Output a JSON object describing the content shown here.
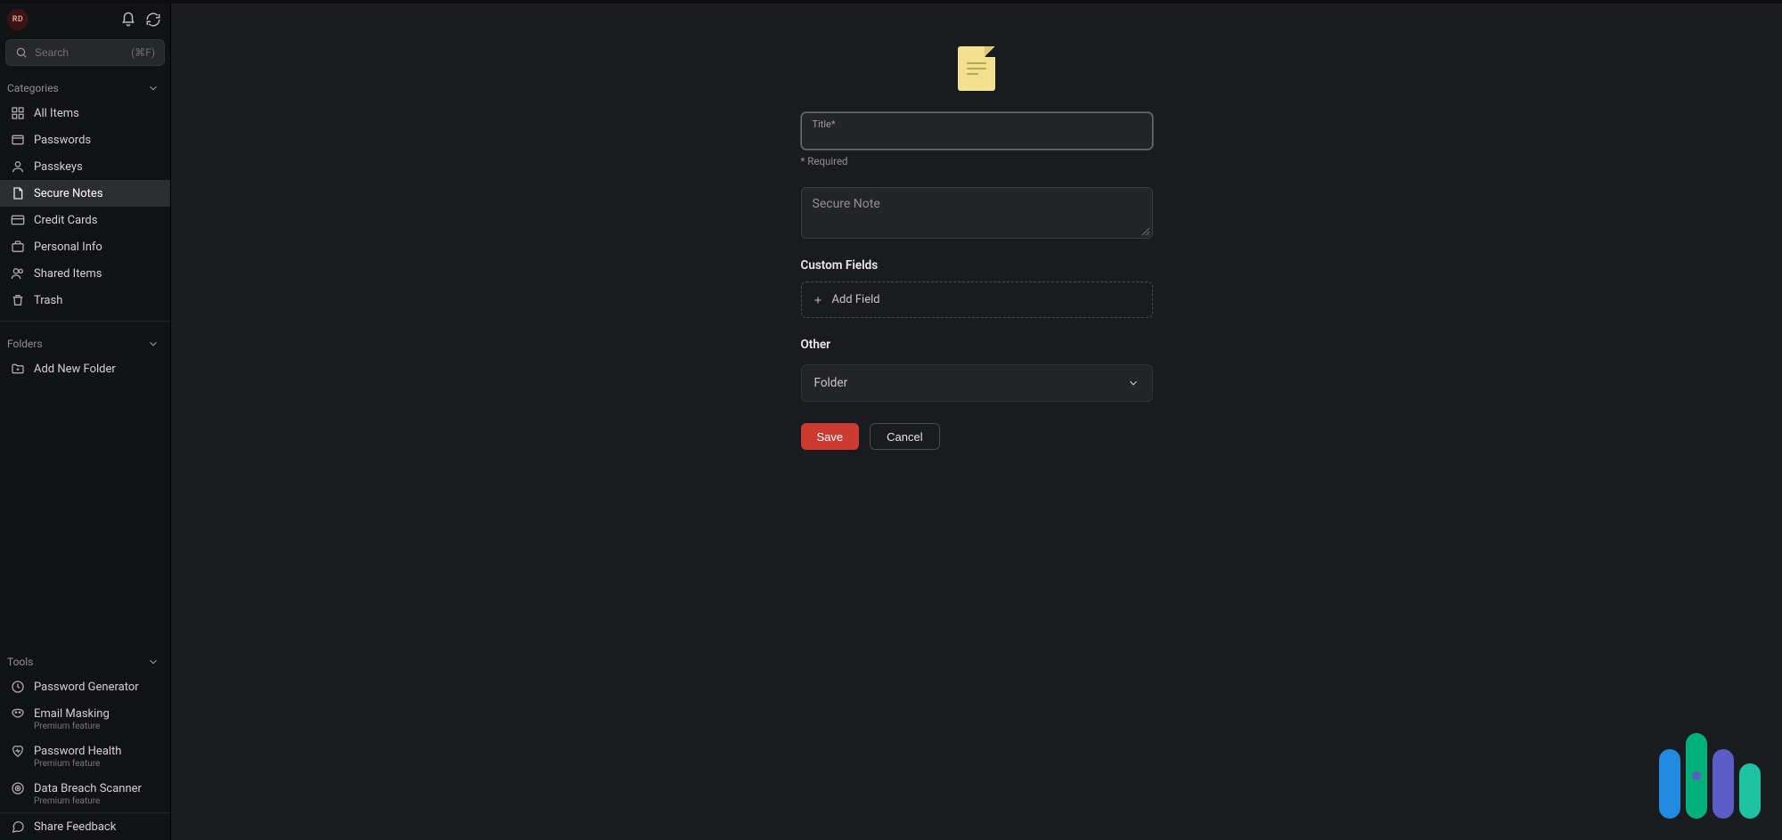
{
  "avatar": {
    "initials": "RD"
  },
  "search": {
    "placeholder": "Search",
    "hint": "(⌘F)",
    "value": ""
  },
  "sections": {
    "categories": {
      "label": "Categories",
      "items": [
        {
          "id": "all-items",
          "label": "All Items"
        },
        {
          "id": "passwords",
          "label": "Passwords"
        },
        {
          "id": "passkeys",
          "label": "Passkeys"
        },
        {
          "id": "secure-notes",
          "label": "Secure Notes"
        },
        {
          "id": "credit-cards",
          "label": "Credit Cards"
        },
        {
          "id": "personal-info",
          "label": "Personal Info"
        },
        {
          "id": "shared-items",
          "label": "Shared Items"
        },
        {
          "id": "trash",
          "label": "Trash"
        }
      ],
      "activeId": "secure-notes"
    },
    "folders": {
      "label": "Folders",
      "items": [
        {
          "id": "add-new-folder",
          "label": "Add New Folder"
        }
      ]
    },
    "tools": {
      "label": "Tools",
      "items": [
        {
          "id": "pw-generator",
          "label": "Password Generator",
          "sub": null
        },
        {
          "id": "email-mask",
          "label": "Email Masking",
          "sub": "Premium feature"
        },
        {
          "id": "pw-health",
          "label": "Password Health",
          "sub": "Premium feature"
        },
        {
          "id": "breach-scan",
          "label": "Data Breach Scanner",
          "sub": "Premium feature"
        }
      ]
    }
  },
  "footer": {
    "share_feedback": "Share Feedback"
  },
  "form": {
    "title_label": "Title*",
    "title_value": "",
    "required_note": "* Required",
    "secure_note_placeholder": "Secure Note",
    "secure_note_value": "",
    "custom_fields_header": "Custom Fields",
    "add_field_label": "Add Field",
    "other_header": "Other",
    "folder_select_label": "Folder",
    "save_label": "Save",
    "cancel_label": "Cancel"
  }
}
